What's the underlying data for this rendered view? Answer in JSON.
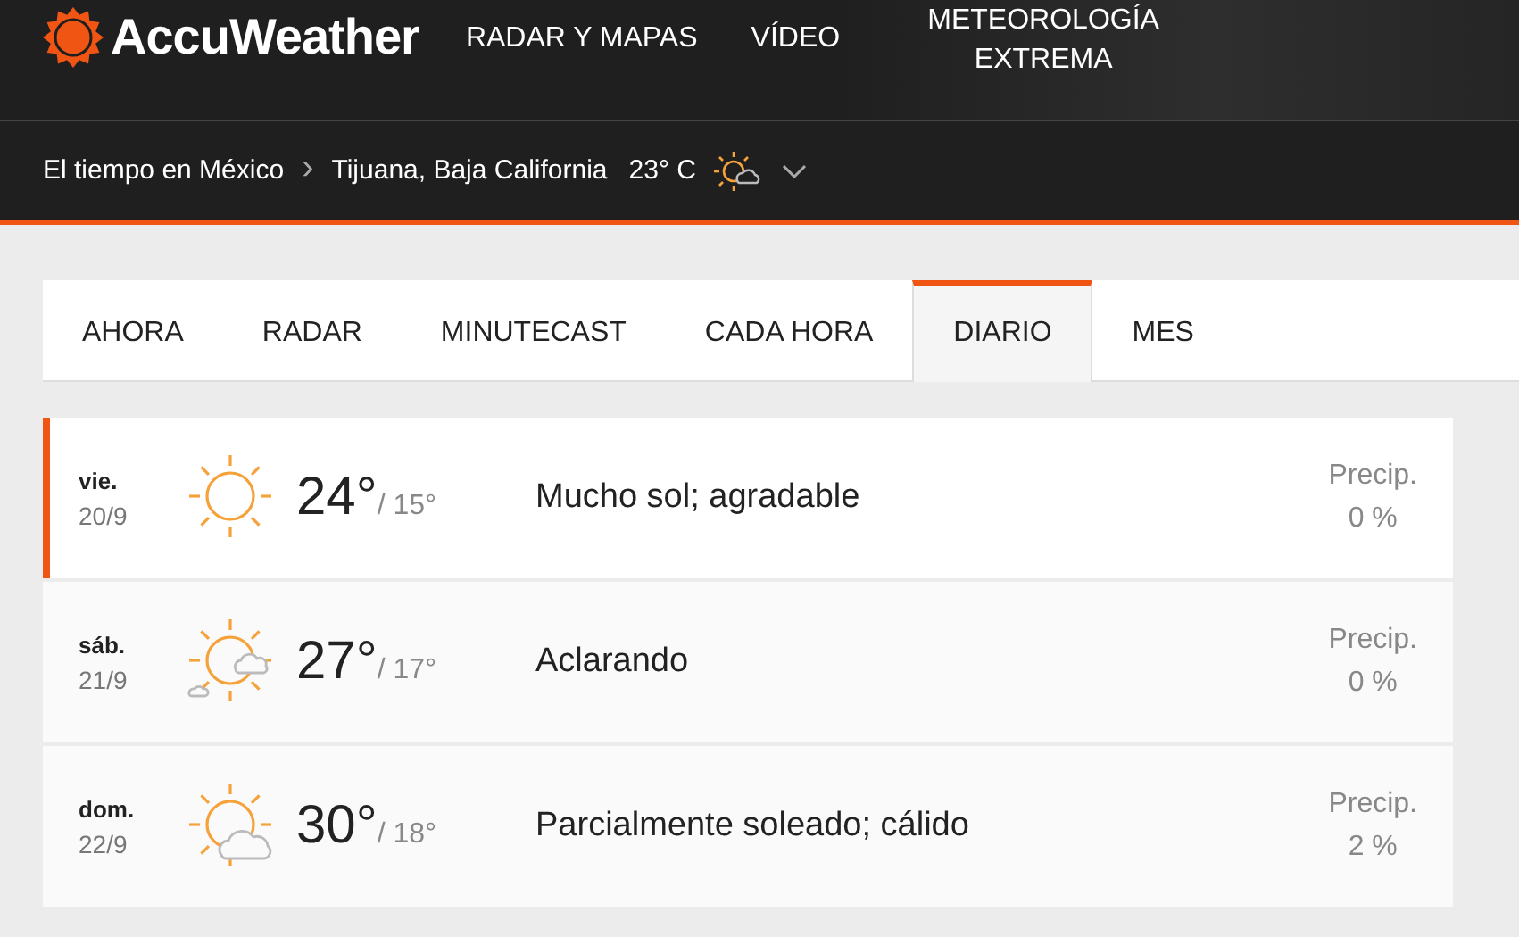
{
  "header": {
    "logo": "AccuWeather",
    "nav": [
      "RADAR Y MAPAS",
      "VÍDEO",
      "METEOROLOGÍA EXTREMA"
    ]
  },
  "breadcrumb": {
    "country": "El tiempo en México",
    "separator": "›",
    "location": "Tijuana, Baja California",
    "temperature": "23° C"
  },
  "tabs": [
    {
      "label": "AHORA",
      "selected": false
    },
    {
      "label": "RADAR",
      "selected": false
    },
    {
      "label": "MINUTECAST",
      "selected": false
    },
    {
      "label": "CADA HORA",
      "selected": false
    },
    {
      "label": "DIARIO",
      "selected": true
    },
    {
      "label": "MES",
      "selected": false
    }
  ],
  "days": [
    {
      "day": "vie.",
      "date": "20/9",
      "kind": "sunny",
      "high": "24°",
      "low": "/ 15°",
      "phrase": "Mucho sol; agradable",
      "precip_label": "Precip.",
      "precip": "0 %",
      "selected": true
    },
    {
      "day": "sáb.",
      "date": "21/9",
      "kind": "clearing",
      "high": "27°",
      "low": "/ 17°",
      "phrase": "Aclarando",
      "precip_label": "Precip.",
      "precip": "0 %",
      "selected": false
    },
    {
      "day": "dom.",
      "date": "22/9",
      "kind": "partly",
      "high": "30°",
      "low": "/ 18°",
      "phrase": "Parcialmente soleado; cálido",
      "precip_label": "Precip.",
      "precip": "2 %",
      "selected": false
    }
  ]
}
